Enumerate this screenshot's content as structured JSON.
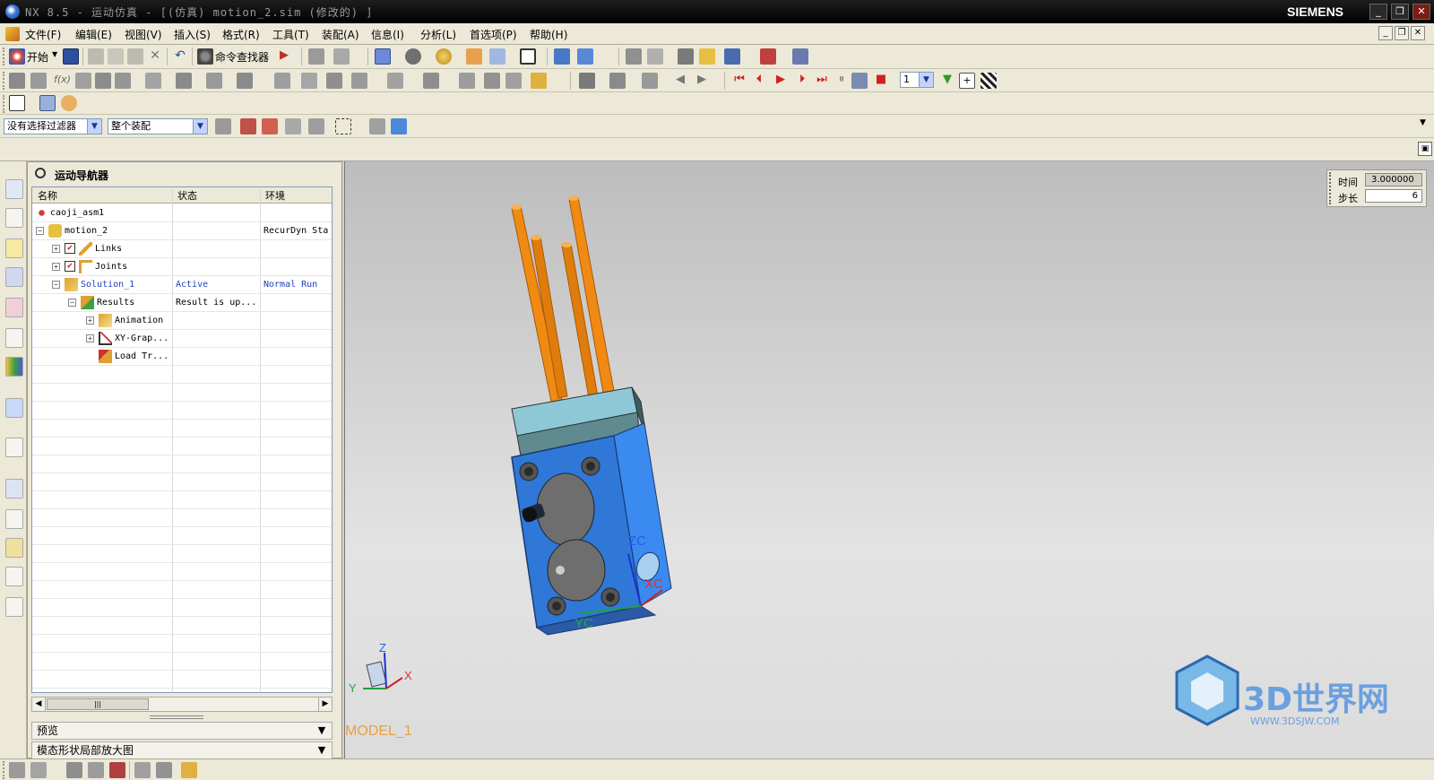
{
  "window": {
    "title": "NX 8.5 - 运动仿真 - [(仿真) motion_2.sim (修改的) ]",
    "brand": "SIEMENS"
  },
  "menu": {
    "items": [
      "文件(F)",
      "编辑(E)",
      "视图(V)",
      "插入(S)",
      "格式(R)",
      "工具(T)",
      "装配(A)",
      "信息(I)",
      "分析(L)",
      "首选项(P)",
      "帮助(H)"
    ]
  },
  "toolbar": {
    "start_label": "开始",
    "command_finder_label": "命令查找器",
    "step_value": "1"
  },
  "selection_bar": {
    "filter_value": "没有选择过滤器",
    "scope_value": "整个装配"
  },
  "navigator": {
    "title": "运动导航器",
    "columns": [
      "名称",
      "状态",
      "环境"
    ],
    "rows": [
      {
        "name": "caoji_asm1",
        "status": "",
        "env": ""
      },
      {
        "name": "motion_2",
        "status": "",
        "env": "RecurDyn Sta"
      },
      {
        "name": "Links",
        "status": "",
        "env": ""
      },
      {
        "name": "Joints",
        "status": "",
        "env": ""
      },
      {
        "name": "Solution_1",
        "status": "Active",
        "env": "Normal Run"
      },
      {
        "name": "Results",
        "status": "Result is up...",
        "env": ""
      },
      {
        "name": "Animation",
        "status": "",
        "env": ""
      },
      {
        "name": "XY-Grap...",
        "status": "",
        "env": ""
      },
      {
        "name": "Load Tr...",
        "status": "",
        "env": ""
      }
    ],
    "preview_label": "预览",
    "modal_label": "模态形状局部放大图"
  },
  "viewport": {
    "model_label": "MODEL_1",
    "time_label": "时间",
    "time_value": "3.000000",
    "step_label": "步长",
    "step_value": "6",
    "wcs_labels": {
      "zc": "ZC",
      "xc": "XC",
      "yc": "YC"
    },
    "triad": {
      "z": "Z",
      "x": "X",
      "y": "Y"
    },
    "watermark": "3D世界网",
    "watermark_url": "WWW.3DSJW.COM"
  },
  "colors": {
    "rod": "#f08a12",
    "body": "#2f78d8",
    "top_block": "#6aa0a8",
    "disc": "#6e6e6e",
    "viewport_top": "#bdbdbd",
    "model_label": "#e8a040"
  }
}
